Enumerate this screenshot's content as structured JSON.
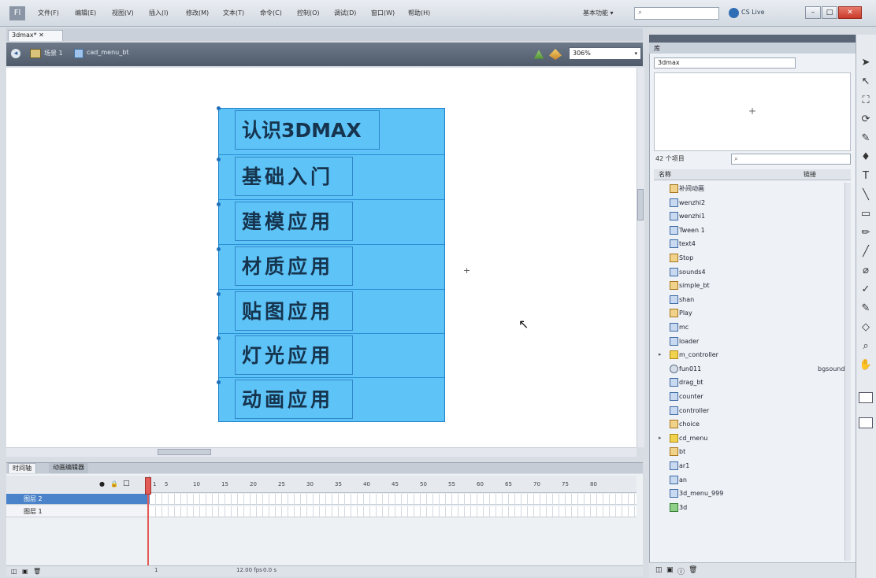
{
  "menubar": {
    "logo": "Fl",
    "items": [
      "文件(F)",
      "编辑(E)",
      "视图(V)",
      "插入(I)",
      "修改(M)",
      "文本(T)",
      "命令(C)",
      "控制(O)",
      "调试(D)",
      "窗口(W)",
      "帮助(H)"
    ],
    "workspace_label": "基本功能 ▾",
    "search_icon": "⌕",
    "cslive_label": "CS Live",
    "window_buttons": [
      "–",
      "□",
      "✕"
    ]
  },
  "document": {
    "tab_label": "3dmax* ✕",
    "breadcrumb_scene": "场景 1",
    "breadcrumb_symbol": "cad_menu_bt",
    "zoom": "306%"
  },
  "stage": {
    "menu_items": [
      "认识3DMAX",
      "基础入门",
      "建模应用",
      "材质应用",
      "贴图应用",
      "灯光应用",
      "动画应用"
    ],
    "reg_point": "+",
    "cursor": "↖"
  },
  "timeline": {
    "tabs": [
      "时间轴",
      "动画编辑器"
    ],
    "ticks": [
      "1",
      "5",
      "10",
      "15",
      "20",
      "25",
      "30",
      "35",
      "40",
      "45",
      "50",
      "55",
      "60",
      "65",
      "70",
      "75",
      "80"
    ],
    "layers": [
      "图层 2",
      "图层 1"
    ],
    "current_frame": "1",
    "fps": "12.00 fps",
    "time": "0.0 s"
  },
  "library": {
    "tab_label": "库",
    "document_select": "3dmax",
    "item_count": "42 个项目",
    "search_icon": "⌕",
    "col_name": "名称",
    "col_linkage": "链接",
    "items": [
      {
        "name": "补间动画",
        "type": "btn"
      },
      {
        "name": "wenzhi2",
        "type": "mc"
      },
      {
        "name": "wenzhi1",
        "type": "mc"
      },
      {
        "name": "Tween 1",
        "type": "mc"
      },
      {
        "name": "text4",
        "type": "mc"
      },
      {
        "name": "Stop",
        "type": "btn"
      },
      {
        "name": "sounds4",
        "type": "mc"
      },
      {
        "name": "simple_bt",
        "type": "btn"
      },
      {
        "name": "shan",
        "type": "mc"
      },
      {
        "name": "Play",
        "type": "btn"
      },
      {
        "name": "mc",
        "type": "mc"
      },
      {
        "name": "loader",
        "type": "mc"
      },
      {
        "name": "m_controller",
        "type": "folder",
        "expand": "▸"
      },
      {
        "name": "fun011",
        "type": "sound",
        "linkage": "bgsound"
      },
      {
        "name": "drag_bt",
        "type": "mc"
      },
      {
        "name": "counter",
        "type": "mc"
      },
      {
        "name": "controller",
        "type": "mc"
      },
      {
        "name": "choice",
        "type": "btn"
      },
      {
        "name": "cd_menu",
        "type": "folder",
        "expand": "▸"
      },
      {
        "name": "bt",
        "type": "btn"
      },
      {
        "name": "ar1",
        "type": "mc"
      },
      {
        "name": "an",
        "type": "mc"
      },
      {
        "name": "3d_menu_999",
        "type": "mc"
      },
      {
        "name": "3d",
        "type": "graphic"
      }
    ]
  },
  "tools": [
    "➤",
    "↖",
    "⛶",
    "⟳",
    "✎",
    "♦",
    "T",
    "╲",
    "▭",
    "✏",
    "╱",
    "⌀",
    "✓",
    "✎",
    "◇",
    "⌕",
    "✋"
  ],
  "colors": {
    "menu_fill": "#5ec3f7",
    "menu_border": "#1f7fc8",
    "selected_layer": "#4a83c9",
    "playhead": "#e35b57"
  }
}
